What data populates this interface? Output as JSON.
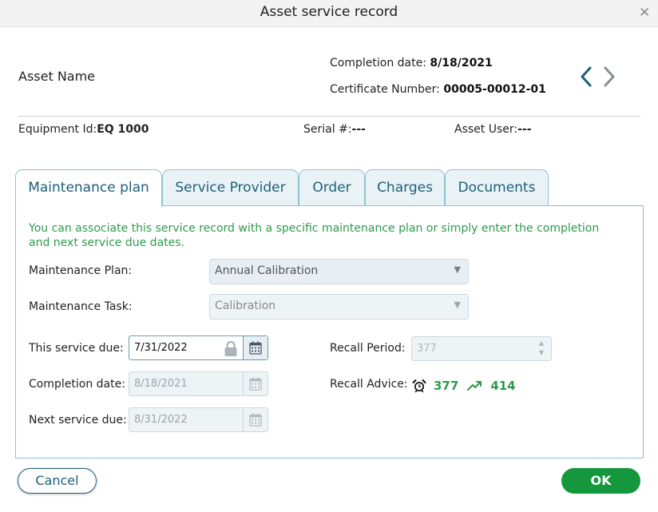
{
  "window": {
    "title": "Asset service record",
    "close_icon": "close-icon"
  },
  "header": {
    "asset_name": "Asset Name",
    "completion_label": "Completion date: ",
    "completion_value": "8/18/2021",
    "certificate_label": "Certificate Number: ",
    "certificate_value": "00005-00012-01"
  },
  "meta": {
    "equipment_label": "Equipment Id:",
    "equipment_value": "EQ 1000",
    "serial_label": "Serial #:",
    "serial_value": "---",
    "user_label": "Asset User:",
    "user_value": "---"
  },
  "tabs": [
    {
      "label": "Maintenance plan",
      "active": true
    },
    {
      "label": "Service Provider",
      "active": false
    },
    {
      "label": "Order",
      "active": false
    },
    {
      "label": "Charges",
      "active": false
    },
    {
      "label": "Documents",
      "active": false
    }
  ],
  "panel": {
    "info_text": "You can associate this service record with a specific maintenance plan or simply enter the completion and next service due dates.",
    "maintenance_plan_label": "Maintenance Plan:",
    "maintenance_plan_value": "Annual Calibration",
    "maintenance_task_label": "Maintenance Task:",
    "maintenance_task_value": "Calibration",
    "this_service_due_label": "This service due:",
    "this_service_due_value": "7/31/2022",
    "completion_date_label": "Completion date:",
    "completion_date_value": "8/18/2021",
    "next_service_due_label": "Next service due:",
    "next_service_due_value": "8/31/2022",
    "recall_period_label": "Recall Period:",
    "recall_period_value": "377",
    "recall_advice_label": "Recall Advice:",
    "recall_advice_current": "377",
    "recall_advice_next": "414"
  },
  "footer": {
    "cancel_label": "Cancel",
    "ok_label": "OK"
  },
  "colors": {
    "accent": "#1d5f7a",
    "success": "#14973d",
    "info_text": "#2e9a4e",
    "tab_border": "#8fc1cf"
  }
}
